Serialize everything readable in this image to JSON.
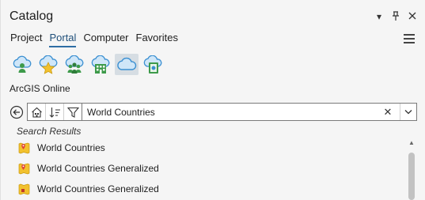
{
  "pane": {
    "title": "Catalog",
    "controls": [
      "menu-arrow",
      "pin",
      "close"
    ]
  },
  "tabs": [
    {
      "label": "Project",
      "active": false
    },
    {
      "label": "Portal",
      "active": true
    },
    {
      "label": "Computer",
      "active": false
    },
    {
      "label": "Favorites",
      "active": false
    }
  ],
  "toolbar": {
    "icons": [
      {
        "name": "my-content-icon",
        "selected": false
      },
      {
        "name": "my-favorites-icon",
        "selected": false
      },
      {
        "name": "my-groups-icon",
        "selected": false
      },
      {
        "name": "my-organization-icon",
        "selected": false
      },
      {
        "name": "arcgis-online-icon",
        "selected": true
      },
      {
        "name": "living-atlas-icon",
        "selected": false
      }
    ]
  },
  "section": {
    "label": "ArcGIS Online"
  },
  "search": {
    "value": "World Countries",
    "clear_glyph": "✕"
  },
  "results": {
    "heading": "Search Results",
    "items": [
      {
        "label": "World Countries",
        "icon": "feature-layer-icon"
      },
      {
        "label": "World Countries Generalized",
        "icon": "feature-layer-icon"
      },
      {
        "label": "World Countries Generalized",
        "icon": "feature-layer-icon"
      }
    ]
  },
  "colors": {
    "accent": "#2e6da4",
    "selected_bg": "#d6dde3",
    "icon_blue": "#3a8fd1",
    "icon_green": "#3d9a4a",
    "icon_yellow": "#f2c12e"
  }
}
